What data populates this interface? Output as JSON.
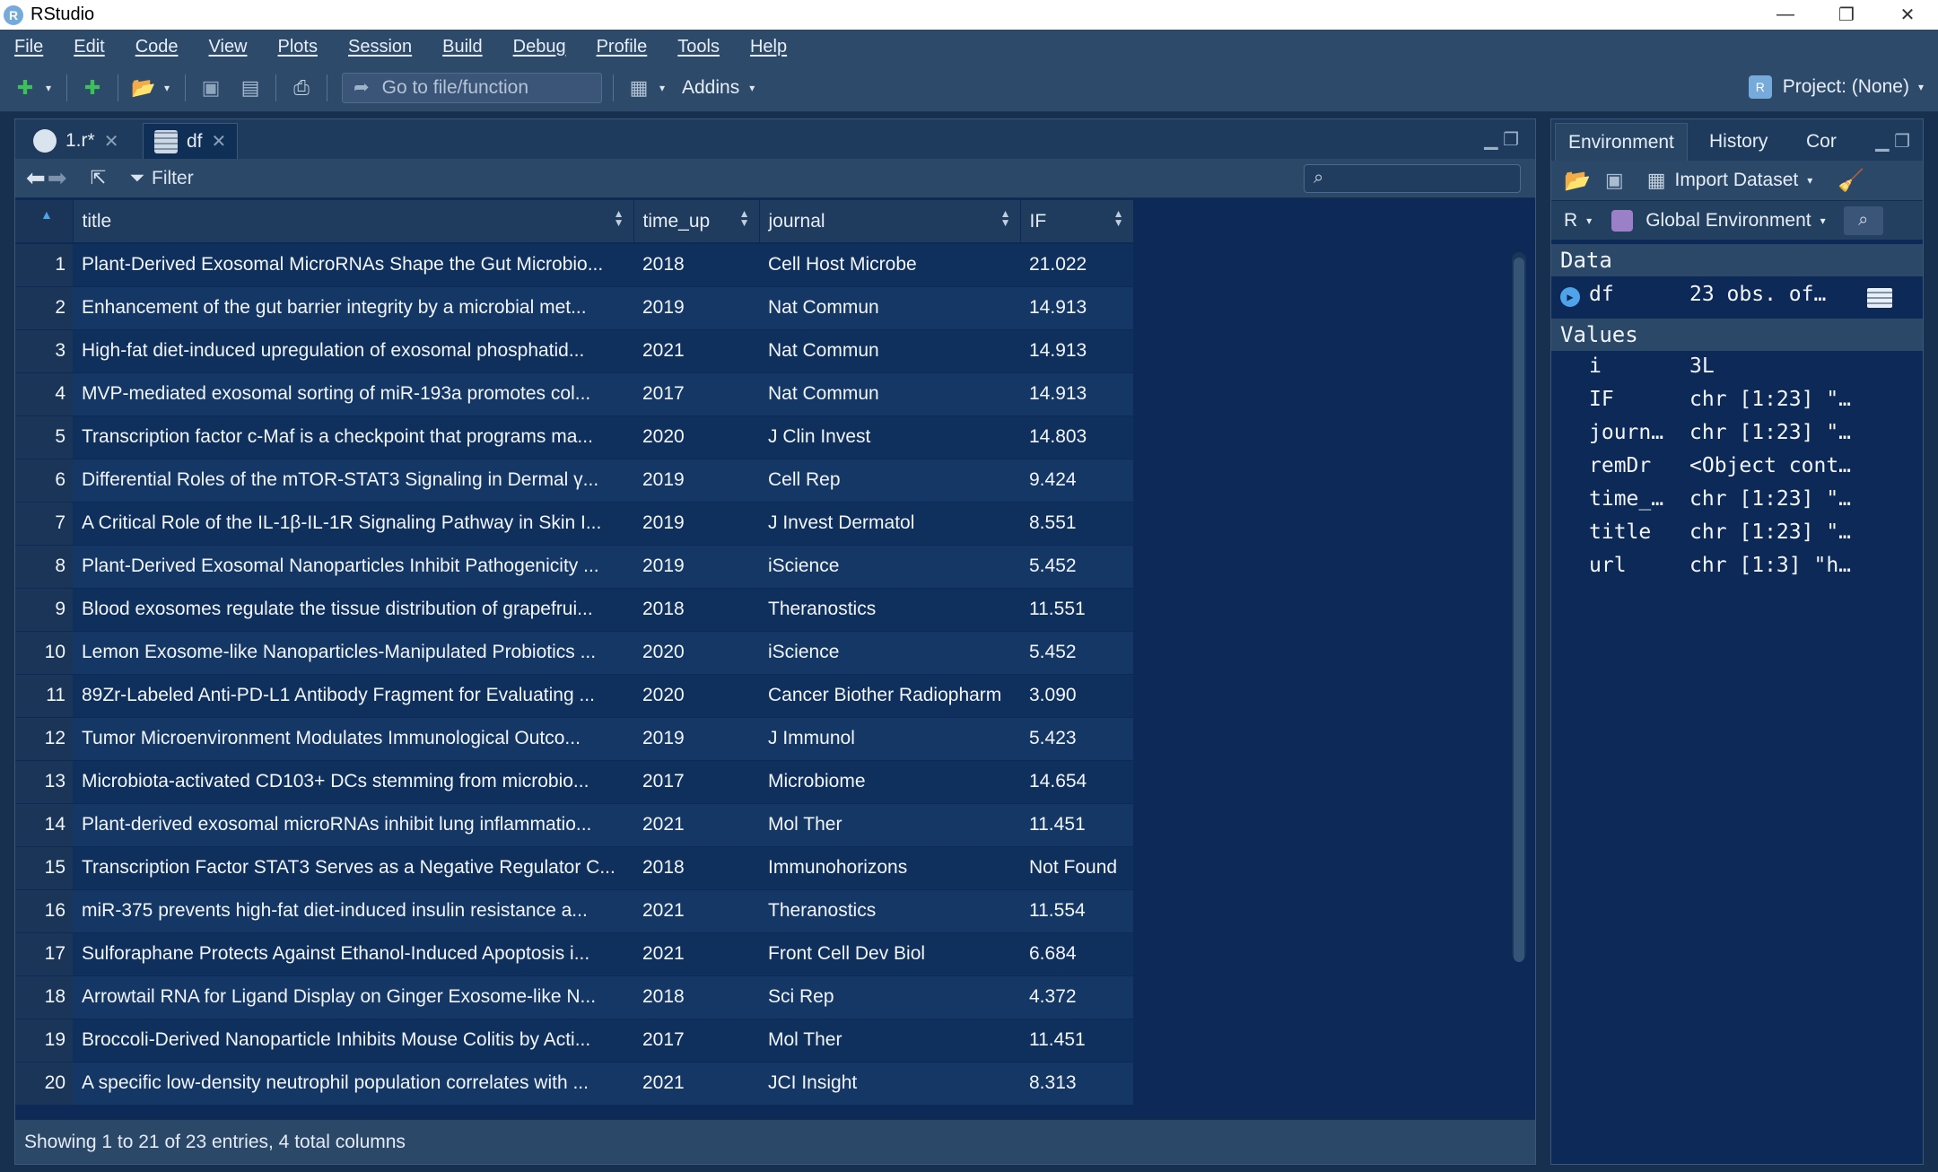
{
  "window": {
    "title": "RStudio",
    "icon_label": "R",
    "controls": {
      "minimize": "—",
      "maximize": "❐",
      "close": "✕"
    }
  },
  "menu": [
    "File",
    "Edit",
    "Code",
    "View",
    "Plots",
    "Session",
    "Build",
    "Debug",
    "Profile",
    "Tools",
    "Help"
  ],
  "toolbar": {
    "goto_placeholder": "Go to file/function",
    "addins_label": "Addins",
    "project_label": "Project: (None)"
  },
  "source": {
    "tabs": [
      {
        "label": "1.r*"
      },
      {
        "label": "df"
      }
    ],
    "filter_label": "Filter",
    "columns": [
      "title",
      "time_up",
      "journal",
      "IF"
    ],
    "rows": [
      [
        "1",
        "Plant-Derived Exosomal MicroRNAs Shape the Gut Microbio...",
        "2018",
        "Cell Host Microbe",
        "21.022"
      ],
      [
        "2",
        "Enhancement of the gut barrier integrity by a microbial met...",
        "2019",
        "Nat Commun",
        "14.913"
      ],
      [
        "3",
        "High-fat diet-induced upregulation of exosomal phosphatid...",
        "2021",
        "Nat Commun",
        "14.913"
      ],
      [
        "4",
        "MVP-mediated exosomal sorting of miR-193a promotes col...",
        "2017",
        "Nat Commun",
        "14.913"
      ],
      [
        "5",
        "Transcription factor c-Maf is a checkpoint that programs ma...",
        "2020",
        "J Clin Invest",
        "14.803"
      ],
      [
        "6",
        "Differential Roles of the mTOR-STAT3 Signaling in Dermal γ...",
        "2019",
        "Cell Rep",
        "9.424"
      ],
      [
        "7",
        "A Critical Role of the IL-1β-IL-1R Signaling Pathway in Skin I...",
        "2019",
        "J Invest Dermatol",
        "8.551"
      ],
      [
        "8",
        "Plant-Derived Exosomal Nanoparticles Inhibit Pathogenicity ...",
        "2019",
        "iScience",
        "5.452"
      ],
      [
        "9",
        "Blood exosomes regulate the tissue distribution of grapefrui...",
        "2018",
        "Theranostics",
        "11.551"
      ],
      [
        "10",
        "Lemon Exosome-like Nanoparticles-Manipulated Probiotics ...",
        "2020",
        "iScience",
        "5.452"
      ],
      [
        "11",
        "89Zr-Labeled Anti-PD-L1 Antibody Fragment for Evaluating ...",
        "2020",
        "Cancer Biother Radiopharm",
        "3.090"
      ],
      [
        "12",
        "Tumor Microenvironment Modulates Immunological Outco...",
        "2019",
        "J Immunol",
        "5.423"
      ],
      [
        "13",
        "Microbiota-activated CD103+ DCs stemming from microbio...",
        "2017",
        "Microbiome",
        "14.654"
      ],
      [
        "14",
        "Plant-derived exosomal microRNAs inhibit lung inflammatio...",
        "2021",
        "Mol Ther",
        "11.451"
      ],
      [
        "15",
        "Transcription Factor STAT3 Serves as a Negative Regulator C...",
        "2018",
        "Immunohorizons",
        "Not Found"
      ],
      [
        "16",
        "miR-375 prevents high-fat diet-induced insulin resistance a...",
        "2021",
        "Theranostics",
        "11.554"
      ],
      [
        "17",
        "Sulforaphane Protects Against Ethanol-Induced Apoptosis i...",
        "2021",
        "Front Cell Dev Biol",
        "6.684"
      ],
      [
        "18",
        "Arrowtail RNA for Ligand Display on Ginger Exosome-like N...",
        "2018",
        "Sci Rep",
        "4.372"
      ],
      [
        "19",
        "Broccoli-Derived Nanoparticle Inhibits Mouse Colitis by Acti...",
        "2017",
        "Mol Ther",
        "11.451"
      ],
      [
        "20",
        "A specific low-density neutrophil population correlates with ...",
        "2021",
        "JCI Insight",
        "8.313"
      ]
    ],
    "status": "Showing 1 to 21 of 23 entries, 4 total columns"
  },
  "environment": {
    "tabs": [
      "Environment",
      "History",
      "Cor"
    ],
    "import_label": "Import Dataset",
    "lang_label": "R",
    "scope_label": "Global Environment",
    "data_header": "Data",
    "data_rows": [
      {
        "name": "df",
        "value": "23 obs. of…"
      }
    ],
    "values_header": "Values",
    "values": [
      {
        "name": "i",
        "value": "3L"
      },
      {
        "name": "IF",
        "value": "chr [1:23] \"…"
      },
      {
        "name": "journ…",
        "value": "chr [1:23] \"…"
      },
      {
        "name": "remDr",
        "value": "<Object cont…"
      },
      {
        "name": "time_…",
        "value": "chr [1:23] \"…"
      },
      {
        "name": "title",
        "value": "chr [1:23] \"…"
      },
      {
        "name": "url",
        "value": "chr [1:3] \"h…"
      }
    ]
  }
}
